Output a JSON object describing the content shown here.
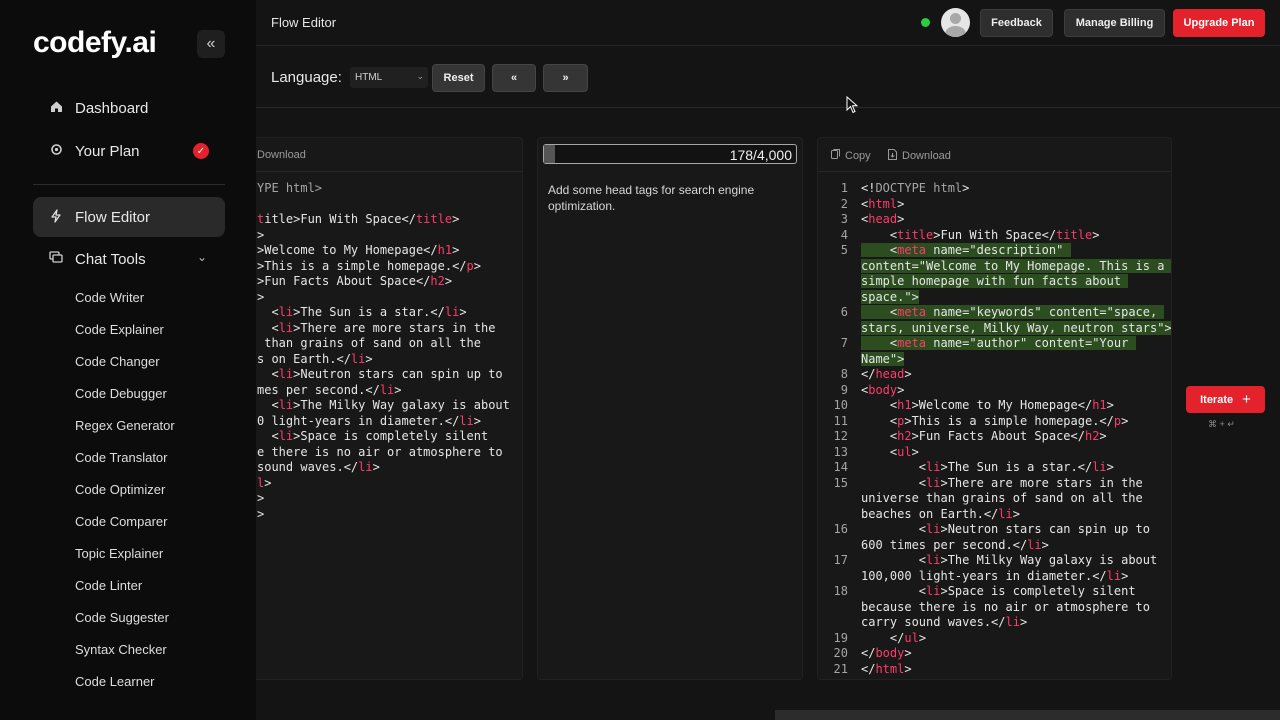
{
  "sidebar": {
    "logo": "codefy.ai",
    "collapse_glyph": "«",
    "nav": [
      {
        "label": "Dashboard",
        "icon": "home-icon"
      },
      {
        "label": "Your Plan",
        "icon": "gear-icon"
      },
      {
        "label": "Flow Editor",
        "icon": "bolt-icon"
      },
      {
        "label": "Chat Tools",
        "icon": "chat-icon"
      }
    ],
    "tools": [
      "Code Writer",
      "Code Explainer",
      "Code Changer",
      "Code Debugger",
      "Regex Generator",
      "Code Translator",
      "Code Optimizer",
      "Code Comparer",
      "Topic Explainer",
      "Code Linter",
      "Code Suggester",
      "Syntax Checker",
      "Code Learner"
    ]
  },
  "header": {
    "title": "Flow Editor",
    "feedback": "Feedback",
    "billing": "Manage Billing",
    "upgrade": "Upgrade Plan"
  },
  "controls": {
    "language_label": "Language:",
    "language_value": "HTML",
    "reset": "Reset",
    "prev": "«",
    "next": "»"
  },
  "input_panel": {
    "download": "Download",
    "lines": [
      "YPE html>",
      "",
      "itle>Fun With Space</title>",
      "",
      ">Welcome to My Homepage</h1>",
      ">This is a simple homepage.</p>",
      ">Fun Facts About Space</h2>",
      "",
      "  <li>The Sun is a star.</li>",
      "  <li>There are more stars in the",
      " than grains of sand on all the",
      "s on Earth.</li>",
      "  <li>Neutron stars can spin up to",
      "mes per second.</li>",
      "  <li>The Milky Way galaxy is about",
      " light-years in diameter.</li>",
      "  <li>Space is completely silent",
      " there is no air or atmosphere to",
      "sound waves.</li>",
      "l>"
    ]
  },
  "prompt_panel": {
    "counter": "178/4,000",
    "progress": 0.045,
    "text": "Add some head tags for search engine optimization."
  },
  "output_panel": {
    "copy": "Copy",
    "download": "Download",
    "line_numbers": [
      "1",
      "2",
      "3",
      "4",
      "5",
      "",
      "",
      "",
      "6",
      "",
      "7",
      "",
      "8",
      "9",
      "10",
      "11",
      "12",
      "13",
      "14",
      "15",
      "",
      "",
      "16",
      "",
      "17",
      "",
      "18",
      "",
      "",
      "19",
      "20",
      "21"
    ]
  },
  "iterate": {
    "label": "Iterate",
    "shortcut": "⌘ + ↵"
  }
}
